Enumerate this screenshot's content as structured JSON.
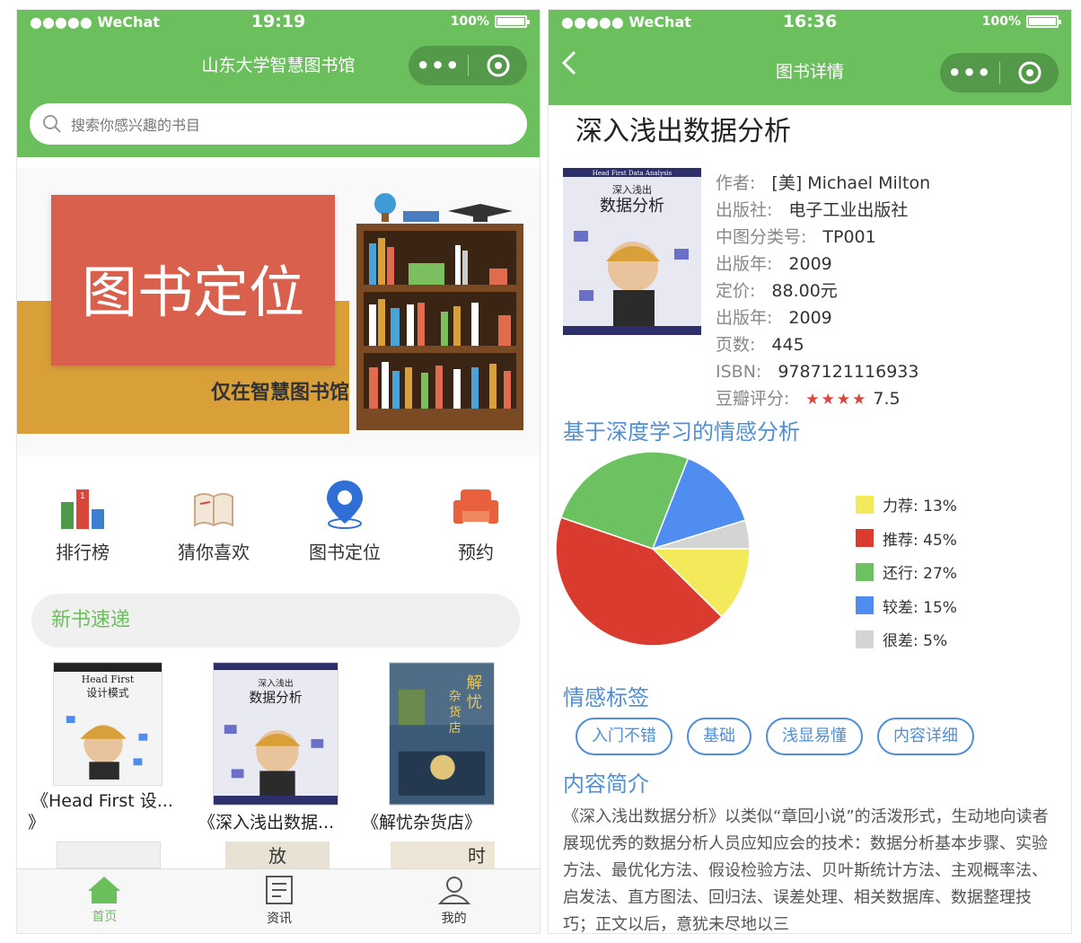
{
  "left": {
    "status": {
      "carrier": "●●●●● WeChat",
      "time": "19:19",
      "battery": "100%"
    },
    "nav_title": "山东大学智慧图书馆",
    "capsule": {
      "dots": "•••"
    },
    "search": {
      "placeholder": "搜索你感兴趣的书目"
    },
    "banner": {
      "title": "图书定位",
      "subtitle": "仅在智慧图书馆"
    },
    "quick": [
      {
        "label": "排行榜",
        "icon": "ranking-icon"
      },
      {
        "label": "猜你喜欢",
        "icon": "book-open-icon"
      },
      {
        "label": "图书定位",
        "icon": "location-pin-icon"
      },
      {
        "label": "预约",
        "icon": "sofa-icon"
      }
    ],
    "section_title": "新书速递",
    "books": [
      {
        "name_line1": "《Head First 设...",
        "name_line2": "》",
        "cover_title": "Head First 设计模式"
      },
      {
        "name": "《深入浅出数据...",
        "cover_title": "深入浅出 数据分析"
      },
      {
        "name": "《解忧杂货店》",
        "cover_title": "解忧杂货店"
      }
    ],
    "books_row2": [
      "放",
      "时"
    ],
    "tabs": [
      {
        "label": "首页",
        "icon": "home-icon"
      },
      {
        "label": "资讯",
        "icon": "news-icon"
      },
      {
        "label": "我的",
        "icon": "user-icon"
      }
    ]
  },
  "right": {
    "status": {
      "carrier": "●●●●● WeChat",
      "time": "16:36",
      "battery": "100%"
    },
    "nav_title": "图书详情",
    "capsule": {
      "dots": "•••"
    },
    "title": "深入浅出数据分析",
    "cover_header": "Head First Data Analysis",
    "cover_title_line1": "深入浅出",
    "cover_title_line2": "数据分析",
    "info": [
      {
        "k": "作者:",
        "v": "[美] Michael Milton"
      },
      {
        "k": "出版社:",
        "v": "电子工业出版社"
      },
      {
        "k": "中图分类号:",
        "v": "TP001"
      },
      {
        "k": "出版年:",
        "v": "2009"
      },
      {
        "k": "定价:",
        "v": "88.00元"
      },
      {
        "k": "出版年:",
        "v": "2009"
      },
      {
        "k": "页数:",
        "v": "445"
      },
      {
        "k": "ISBN:",
        "v": "9787121116933"
      }
    ],
    "rating": {
      "k": "豆瓣评分:",
      "stars": "★★★★",
      "v": "7.5"
    },
    "sentiment_title": "基于深度学习的情感分析",
    "tags_title": "情感标签",
    "tags": [
      "入门不错",
      "基础",
      "浅显易懂",
      "内容详细"
    ],
    "intro_title": "内容简介",
    "intro_text": "《深入浅出数据分析》以类似“章回小说”的活泼形式，生动地向读者展现优秀的数据分析人员应知应会的技术：数据分析基本步骤、实验方法、最优化方法、假设检验方法、贝叶斯统计方法、主观概率法、启发法、直方图法、回归法、误差处理、相关数据库、数据整理技巧；正文以后，意犹未尽地以三"
  },
  "chart_data": {
    "type": "pie",
    "title": "基于深度学习的情感分析",
    "categories": [
      "力荐",
      "推荐",
      "还行",
      "较差",
      "很差"
    ],
    "values": [
      13,
      45,
      27,
      15,
      5
    ],
    "labels": [
      "力荐: 13%",
      "推荐: 45%",
      "还行: 27%",
      "较差: 15%",
      "很差: 5%"
    ],
    "colors": [
      "#f2ea5a",
      "#d93c2f",
      "#6cc160",
      "#4f8ef0",
      "#d4d4d4"
    ],
    "legend_position": "right"
  }
}
